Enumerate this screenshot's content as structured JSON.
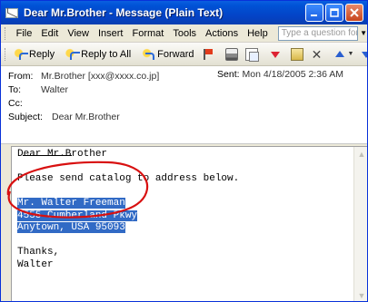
{
  "window": {
    "title": "Dear Mr.Brother - Message (Plain Text)"
  },
  "menu": {
    "items": [
      "File",
      "Edit",
      "View",
      "Insert",
      "Format",
      "Tools",
      "Actions",
      "Help"
    ],
    "help_placeholder": "Type a question for help"
  },
  "toolbar": {
    "reply": "Reply",
    "reply_all": "Reply to All",
    "forward": "Forward"
  },
  "header": {
    "from_label": "From:",
    "from_value": "Mr.Brother [xxx@xxxx.co.jp]",
    "to_label": "To:",
    "to_value": "Walter",
    "cc_label": "Cc:",
    "cc_value": "",
    "sent_label": "Sent:",
    "sent_value": "Mon 4/18/2005 2:36 AM",
    "subject_label": "Subject:",
    "subject_value": "Dear Mr.Brother"
  },
  "body": {
    "lines": [
      "Dear Mr.Brother",
      "",
      "Please send catalog to address below.",
      "",
      "Mr. Walter Freeman",
      "4555 Cumberland Pkwy",
      "Anytown, USA 95093",
      "",
      "Thanks,",
      "Walter"
    ],
    "selected_lines": [
      4,
      5,
      6
    ]
  },
  "colors": {
    "selection": "#316ac5",
    "annotation_circle": "#d81010",
    "title_bar": "#0052d6"
  }
}
